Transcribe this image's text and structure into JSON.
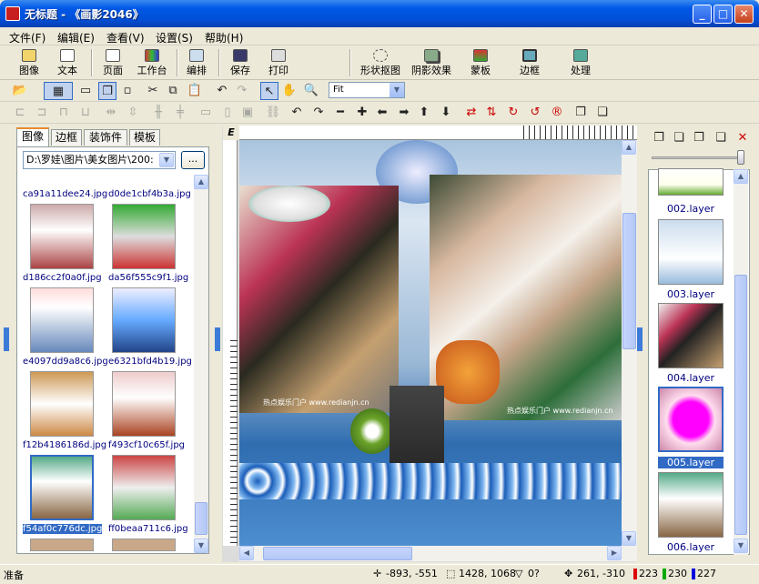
{
  "window": {
    "title": "无标题 - 《画影2046》",
    "minimize_glyph": "_",
    "maximize_glyph": "□",
    "close_glyph": "✕"
  },
  "menu": [
    "文件(F)",
    "编辑(E)",
    "查看(V)",
    "设置(S)",
    "帮助(H)"
  ],
  "big_toolbar": {
    "items": [
      "图像",
      "文本",
      "页面",
      "工作台",
      "编排",
      "保存",
      "打印",
      "形状抠图",
      "阴影效果",
      "蒙板",
      "边框",
      "处理"
    ]
  },
  "zoom": {
    "value": "Fit"
  },
  "left_panel": {
    "tabs": [
      "图像",
      "边框",
      "装饰件",
      "模板"
    ],
    "active_tab": "图像",
    "path": "D:\\罗娃\\图片\\美女图片\\200:",
    "browse_label": "...",
    "files": [
      "ca91a11dee24.jpg",
      "d0de1cbf4b3a.jpg",
      "d186cc2f0a0f.jpg",
      "da56f555c9f1.jpg",
      "e4097dd9a8c6.jpg",
      "e6321bfd4b19.jpg",
      "f12b4186186d.jpg",
      "f493cf10c65f.jpg",
      "f54af0c776dc.jpg",
      "ff0beaa711c6.jpg"
    ],
    "selected_file": "f54af0c776dc.jpg"
  },
  "canvas": {
    "watermark_1": "热点娱乐门户 www.redianjn.cn",
    "watermark_2": "热点娱乐门户 www.redianjn.cn",
    "corner_label": "E"
  },
  "layers": {
    "items": [
      "002.layer",
      "003.layer",
      "004.layer",
      "005.layer",
      "006.layer"
    ],
    "selected": "005.layer"
  },
  "status": {
    "ready": "准备",
    "position": "-893, -551",
    "size": "1428, 1068",
    "angle": "0?",
    "cursor": "261, -310",
    "r": "223",
    "g": "230",
    "b": "227"
  },
  "colors": {
    "title_blue": "#0058e6",
    "selection_blue": "#316ac5",
    "panel_bg": "#ece9d8"
  }
}
